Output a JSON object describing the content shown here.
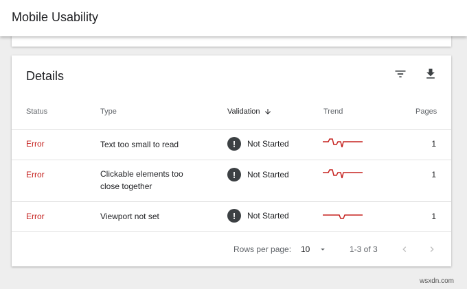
{
  "header": {
    "title": "Mobile Usability"
  },
  "details": {
    "title": "Details",
    "filter_icon": "filter-icon",
    "download_icon": "download-icon",
    "columns": {
      "status": "Status",
      "type": "Type",
      "validation": "Validation",
      "trend": "Trend",
      "pages": "Pages"
    },
    "rows": [
      {
        "status": "Error",
        "type": "Text too small to read",
        "validation": "Not Started",
        "pages": "1"
      },
      {
        "status": "Error",
        "type": "Clickable elements too close together",
        "validation": "Not Started",
        "pages": "1"
      },
      {
        "status": "Error",
        "type": "Viewport not set",
        "validation": "Not Started",
        "pages": "1"
      }
    ],
    "footer": {
      "rows_per_page_label": "Rows per page:",
      "rows_per_page_value": "10",
      "range": "1-3 of 3"
    }
  },
  "watermark": "wsxdn.com",
  "colors": {
    "error": "#c5221f",
    "trend": "#c5221f",
    "icon": "#3c4043"
  }
}
